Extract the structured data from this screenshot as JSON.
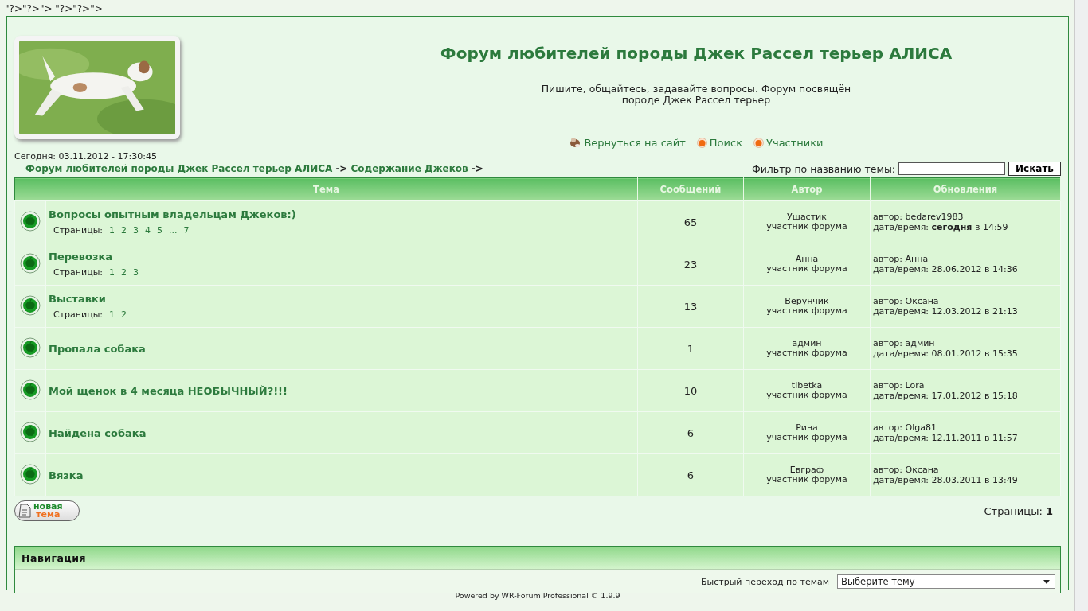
{
  "stray_text": "\"?>\"?>\"> \"?>\"?>\">",
  "header": {
    "title": "Форум любителей породы Джек Рассел терьер АЛИСА",
    "subtitle": "Пишите, общайтесь, задавайте вопросы. Форум посвящён породе Джек Рассел терьер",
    "links": [
      {
        "label": "Вернуться на сайт",
        "kind": "dog"
      },
      {
        "label": "Поиск",
        "kind": "bullet"
      },
      {
        "label": "Участники",
        "kind": "bullet"
      }
    ]
  },
  "today": "Сегодня: 03.11.2012 - 17:30:45",
  "breadcrumb": [
    {
      "label": "Форум любителей породы Джек Рассел терьер АЛИСА",
      "kind": "link"
    },
    {
      "label": "->",
      "kind": "sep"
    },
    {
      "label": "Содержание Джеков",
      "kind": "link"
    },
    {
      "label": "->",
      "kind": "sep"
    }
  ],
  "filter": {
    "label": "Фильтр по названию темы:",
    "button": "Искать"
  },
  "table": {
    "columns": [
      "Тема",
      "Сообщений",
      "Автор",
      "Обновления"
    ],
    "rows": [
      {
        "topic": "Вопросы опытным владельцам Джеков:)",
        "pages_label": "Страницы:",
        "pages": [
          "1",
          "2",
          "3",
          "4",
          "5",
          "...",
          "7"
        ],
        "messages": "65",
        "author": "Ушастик",
        "role": "участник форума",
        "last_author": "автор: bedarev1983",
        "last_date": "дата/время: **сегодня** в 14:59"
      },
      {
        "topic": "Перевозка",
        "pages_label": "Страницы:",
        "pages": [
          "1",
          "2",
          "3"
        ],
        "messages": "23",
        "author": "Анна",
        "role": "участник форума",
        "last_author": "автор: Анна",
        "last_date": "дата/время: 28.06.2012 в 14:36"
      },
      {
        "topic": "Выставки",
        "pages_label": "Страницы:",
        "pages": [
          "1",
          "2"
        ],
        "messages": "13",
        "author": "Верунчик",
        "role": "участник форума",
        "last_author": "автор: Оксана",
        "last_date": "дата/время: 12.03.2012 в 21:13"
      },
      {
        "topic": "Пропала собака",
        "messages": "1",
        "author": "админ",
        "role": "участник форума",
        "last_author": "автор: админ",
        "last_date": "дата/время: 08.01.2012 в 15:35"
      },
      {
        "topic": "Мой щенок в 4 месяца НЕОБЫЧНЫЙ?!!!",
        "messages": "10",
        "author": "tibetka",
        "role": "участник форума",
        "last_author": "автор: Lora",
        "last_date": "дата/время: 17.01.2012 в 15:18"
      },
      {
        "topic": "Найдена собака",
        "messages": "6",
        "author": "Рина",
        "role": "участник форума",
        "last_author": "автор: Olga81",
        "last_date": "дата/время: 12.11.2011 в 11:57"
      },
      {
        "topic": "Вязка",
        "messages": "6",
        "author": "Евграф",
        "role": "участник форума",
        "last_author": "автор: Оксана",
        "last_date": "дата/время: 28.03.2011 в 13:49"
      }
    ]
  },
  "new_topic_button": [
    "новая",
    "тема"
  ],
  "pages": {
    "label": "Страницы:",
    "current": "1"
  },
  "navigation": {
    "title": "Навигация",
    "jump_label": "Быстрый переход по темам",
    "select_value": "Выберите тему"
  },
  "footer": "Powered by WR-Forum Professional © 1.9.9"
}
